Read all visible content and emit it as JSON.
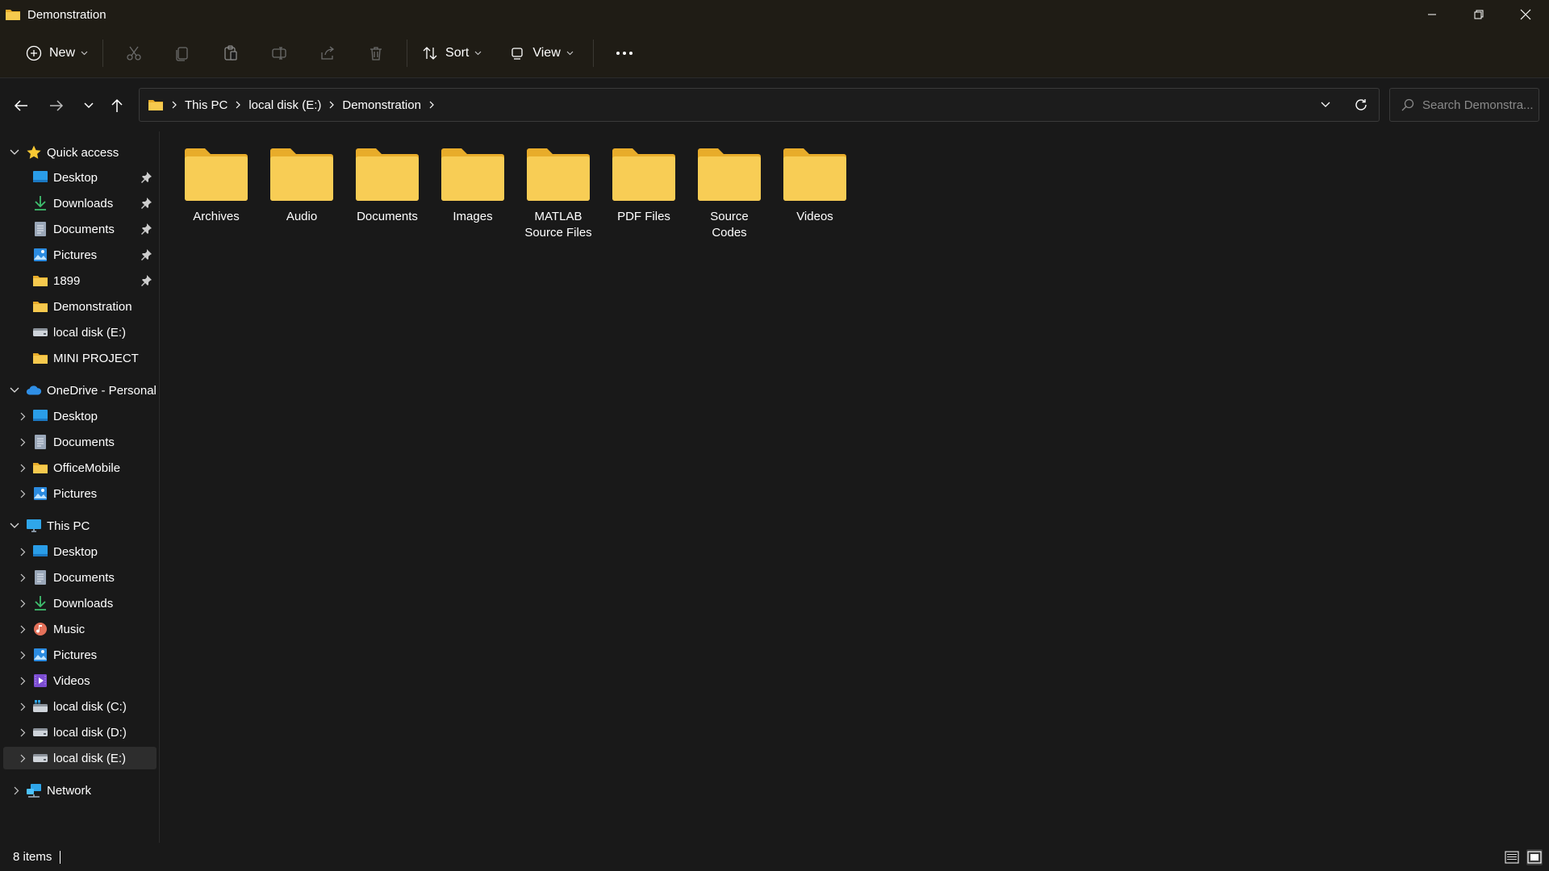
{
  "window": {
    "title": "Demonstration"
  },
  "toolbar": {
    "new_label": "New",
    "sort_label": "Sort",
    "view_label": "View"
  },
  "breadcrumb": [
    "This PC",
    "local disk (E:)",
    "Demonstration"
  ],
  "search": {
    "placeholder": "Search Demonstra..."
  },
  "sidebar": {
    "quick_access": {
      "label": "Quick access",
      "items": [
        {
          "label": "Desktop",
          "icon": "desktop-icon",
          "pinned": true
        },
        {
          "label": "Downloads",
          "icon": "download-icon",
          "pinned": true
        },
        {
          "label": "Documents",
          "icon": "document-icon",
          "pinned": true
        },
        {
          "label": "Pictures",
          "icon": "pictures-icon",
          "pinned": true
        },
        {
          "label": "1899",
          "icon": "folder-icon",
          "pinned": true
        },
        {
          "label": "Demonstration",
          "icon": "folder-icon",
          "pinned": false
        },
        {
          "label": "local disk (E:)",
          "icon": "drive-icon",
          "pinned": false
        },
        {
          "label": "MINI PROJECT",
          "icon": "folder-icon",
          "pinned": false
        }
      ]
    },
    "onedrive": {
      "label": "OneDrive - Personal",
      "items": [
        {
          "label": "Desktop",
          "icon": "desktop-icon"
        },
        {
          "label": "Documents",
          "icon": "document-icon"
        },
        {
          "label": "OfficeMobile",
          "icon": "folder-icon"
        },
        {
          "label": "Pictures",
          "icon": "pictures-icon"
        }
      ]
    },
    "this_pc": {
      "label": "This PC",
      "items": [
        {
          "label": "Desktop",
          "icon": "desktop-icon"
        },
        {
          "label": "Documents",
          "icon": "document-icon"
        },
        {
          "label": "Downloads",
          "icon": "download-icon"
        },
        {
          "label": "Music",
          "icon": "music-icon"
        },
        {
          "label": "Pictures",
          "icon": "pictures-icon"
        },
        {
          "label": "Videos",
          "icon": "videos-icon"
        },
        {
          "label": "local disk (C:)",
          "icon": "windows-drive-icon"
        },
        {
          "label": "local disk (D:)",
          "icon": "drive-icon"
        },
        {
          "label": "local disk (E:)",
          "icon": "drive-icon",
          "selected": true
        }
      ]
    },
    "network": {
      "label": "Network"
    }
  },
  "folders": [
    {
      "name": "Archives"
    },
    {
      "name": "Audio"
    },
    {
      "name": "Documents"
    },
    {
      "name": "Images"
    },
    {
      "name": "MATLAB Source Files"
    },
    {
      "name": "PDF Files"
    },
    {
      "name": "Source Codes"
    },
    {
      "name": "Videos"
    }
  ],
  "status": {
    "item_count": "8 items"
  },
  "colors": {
    "folder": "#f6c94e",
    "folder_dark": "#e8ac2a",
    "accent": "#4cc2ff",
    "titlebar_bg": "#1f1c15",
    "window_bg": "#191919"
  }
}
